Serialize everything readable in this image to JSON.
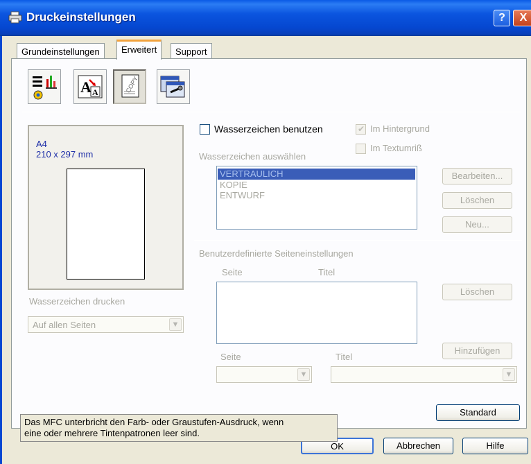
{
  "window": {
    "title": "Druckeinstellungen",
    "help_symbol": "?",
    "close_symbol": "X"
  },
  "tabs": [
    {
      "label": "Grundeinstellungen",
      "active": false
    },
    {
      "label": "Erweitert",
      "active": true
    },
    {
      "label": "Support",
      "active": false
    }
  ],
  "toolbar": {
    "icons": [
      "quality-settings-icon",
      "font-scaling-icon",
      "watermark-copy-icon",
      "device-options-icon"
    ],
    "selected_index": 2,
    "copy_stamp": "COPY"
  },
  "preview": {
    "paper_size": "A4",
    "dimensions": "210 x 297 mm",
    "print_watermark_label": "Wasserzeichen drucken",
    "print_watermark_value": "Auf allen Seiten"
  },
  "watermark": {
    "use_label": "Wasserzeichen benutzen",
    "use_checked": false,
    "background_label": "Im Hintergrund",
    "background_checked": true,
    "outline_label": "Im Textumriß",
    "outline_checked": false,
    "select_label": "Wasserzeichen auswählen",
    "items": [
      "VERTRAULICH",
      "KOPIE",
      "ENTWURF"
    ],
    "selected_item": "VERTRAULICH",
    "edit_button": "Bearbeiten...",
    "delete_button": "Löschen",
    "new_button": "Neu..."
  },
  "custom_pages": {
    "title": "Benutzerdefinierte Seiteneinstellungen",
    "col_page": "Seite",
    "col_title": "Titel",
    "delete_button": "Löschen",
    "add_button": "Hinzufügen",
    "page_label": "Seite",
    "title_label": "Titel",
    "page_value": "",
    "title_value": ""
  },
  "info_text_line1": "Das MFC unterbricht den Farb- oder Graustufen-Ausdruck, wenn",
  "info_text_line2": "eine oder mehrere Tintenpatronen leer sind.",
  "standard_button": "Standard",
  "footer": {
    "ok": "OK",
    "cancel": "Abbrechen",
    "help": "Hilfe"
  },
  "colors": {
    "title_bar": "#0b55df",
    "dialog_bg": "#ece9d8",
    "preview_text": "#1e2fa8",
    "selected_item": "#3a5db8"
  }
}
